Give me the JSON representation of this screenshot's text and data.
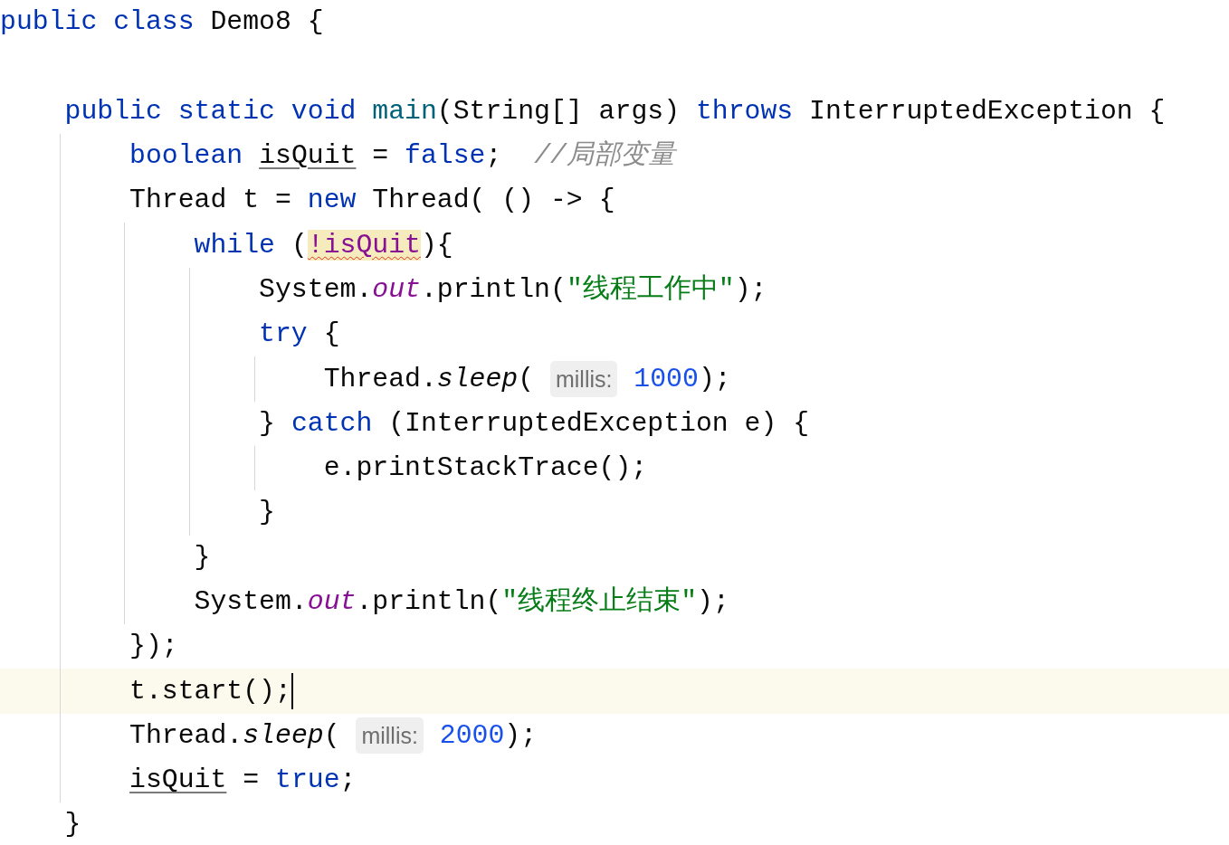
{
  "editor": {
    "lines": [
      {
        "current": false,
        "caret": false,
        "tokens": [
          {
            "kind": "keyword",
            "text": "public class "
          },
          {
            "kind": "plain",
            "text": "Demo8 {"
          }
        ]
      },
      {
        "current": false,
        "caret": false
      },
      {
        "current": false,
        "caret": false,
        "tokens": [
          {
            "kind": "keyword",
            "text": "    public static void "
          },
          {
            "kind": "method",
            "text": "main"
          },
          {
            "kind": "plain",
            "text": "(String[] args) "
          },
          {
            "kind": "keyword",
            "text": "throws "
          },
          {
            "kind": "plain",
            "text": "InterruptedException {"
          }
        ]
      },
      {
        "current": false,
        "caret": false,
        "tokens": [
          {
            "kind": "keyword",
            "text": "        boolean "
          },
          {
            "kind": "variable",
            "text": "isQuit"
          },
          {
            "kind": "plain",
            "text": " = "
          },
          {
            "kind": "keyword",
            "text": "false"
          },
          {
            "kind": "plain",
            "text": ";  "
          },
          {
            "kind": "comment",
            "text": "//局部变量"
          }
        ]
      },
      {
        "current": false,
        "caret": false,
        "tokens": [
          {
            "kind": "plain",
            "text": "        Thread t = "
          },
          {
            "kind": "keyword",
            "text": "new "
          },
          {
            "kind": "plain",
            "text": "Thread( () -> {"
          }
        ]
      },
      {
        "current": false,
        "caret": false,
        "tokens": [
          {
            "kind": "keyword",
            "text": "            while "
          },
          {
            "kind": "plain",
            "text": "("
          },
          {
            "kind": "error",
            "text": "!isQuit"
          },
          {
            "kind": "plain",
            "text": "){"
          }
        ]
      },
      {
        "current": false,
        "caret": false,
        "tokens": [
          {
            "kind": "plain",
            "text": "                System."
          },
          {
            "kind": "field",
            "text": "out"
          },
          {
            "kind": "plain",
            "text": ".println("
          },
          {
            "kind": "string",
            "text": "\"线程工作中\""
          },
          {
            "kind": "plain",
            "text": ");"
          }
        ]
      },
      {
        "current": false,
        "caret": false,
        "tokens": [
          {
            "kind": "keyword",
            "text": "                try "
          },
          {
            "kind": "plain",
            "text": "{"
          }
        ]
      },
      {
        "current": false,
        "caret": false,
        "tokens": [
          {
            "kind": "plain",
            "text": "                    Thread."
          },
          {
            "kind": "static",
            "text": "sleep"
          },
          {
            "kind": "plain",
            "text": "( "
          },
          {
            "kind": "hint",
            "text": "millis:"
          },
          {
            "kind": "number",
            "text": " 1000"
          },
          {
            "kind": "plain",
            "text": ");"
          }
        ]
      },
      {
        "current": false,
        "caret": false,
        "tokens": [
          {
            "kind": "plain",
            "text": "                } "
          },
          {
            "kind": "keyword",
            "text": "catch "
          },
          {
            "kind": "plain",
            "text": "(InterruptedException e) {"
          }
        ]
      },
      {
        "current": false,
        "caret": false,
        "tokens": [
          {
            "kind": "plain",
            "text": "                    e.printStackTrace();"
          }
        ]
      },
      {
        "current": false,
        "caret": false,
        "tokens": [
          {
            "kind": "plain",
            "text": "                }"
          }
        ]
      },
      {
        "current": false,
        "caret": false,
        "tokens": [
          {
            "kind": "plain",
            "text": "            }"
          }
        ]
      },
      {
        "current": false,
        "caret": false,
        "tokens": [
          {
            "kind": "plain",
            "text": "            System."
          },
          {
            "kind": "field",
            "text": "out"
          },
          {
            "kind": "plain",
            "text": ".println("
          },
          {
            "kind": "string",
            "text": "\"线程终止结束\""
          },
          {
            "kind": "plain",
            "text": ");"
          }
        ]
      },
      {
        "current": false,
        "caret": false,
        "tokens": [
          {
            "kind": "plain",
            "text": "        });"
          }
        ]
      },
      {
        "current": true,
        "caret": true,
        "tokens": [
          {
            "kind": "plain",
            "text": "        t.start();"
          }
        ]
      },
      {
        "current": false,
        "caret": false,
        "tokens": [
          {
            "kind": "plain",
            "text": "        Thread."
          },
          {
            "kind": "static",
            "text": "sleep"
          },
          {
            "kind": "plain",
            "text": "( "
          },
          {
            "kind": "hint",
            "text": "millis:"
          },
          {
            "kind": "number",
            "text": " 2000"
          },
          {
            "kind": "plain",
            "text": ");"
          }
        ]
      },
      {
        "current": false,
        "caret": false,
        "tokens": [
          {
            "kind": "variable",
            "text": "        isQuit"
          },
          {
            "kind": "plain",
            "text": " = "
          },
          {
            "kind": "keyword",
            "text": "true"
          },
          {
            "kind": "plain",
            "text": ";"
          }
        ]
      },
      {
        "current": false,
        "caret": false,
        "tokens": [
          {
            "kind": "plain",
            "text": "    }"
          }
        ]
      }
    ]
  }
}
